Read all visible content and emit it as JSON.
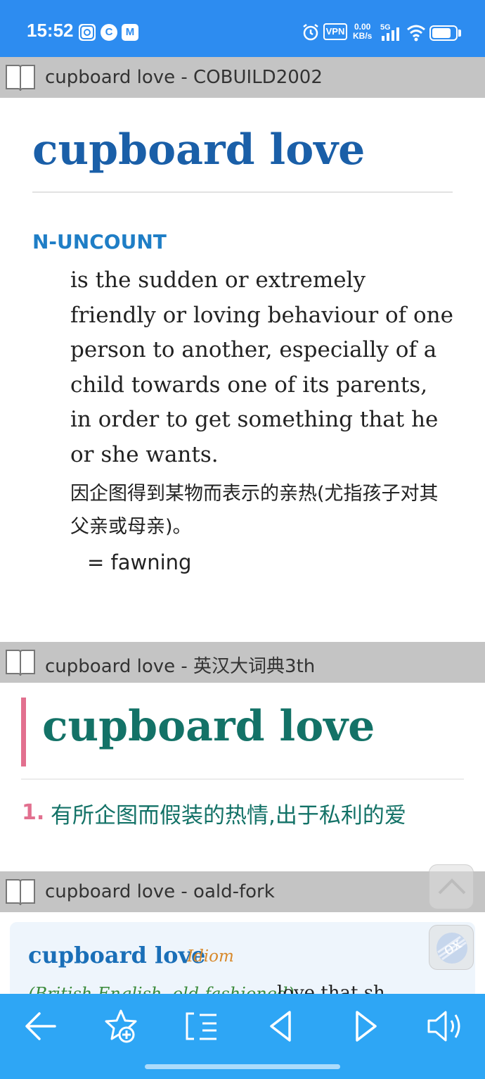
{
  "status_bar": {
    "time": "15:52",
    "app_icons": [
      "photo-app-icon",
      "browser-app-icon",
      "mail-app-icon"
    ],
    "app_letters": [
      "",
      "C",
      "M"
    ],
    "vpn": "VPN",
    "net_speed_value": "0.00",
    "net_speed_unit": "KB/s",
    "network": "5G",
    "battery_level": 0.8
  },
  "sections": {
    "cobuild": {
      "header": "cupboard love - COBUILD2002",
      "headword": "cupboard love",
      "pos": "N-UNCOUNT",
      "definition": "is the sudden or extremely friendly or loving behaviour of one person to another, especially of a child towards one of its parents, in order to get something that he or she wants.",
      "translation": "因企图得到某物而表示的亲热(尤指孩子对其父亲或母亲)。",
      "synonym": "= fawning"
    },
    "yinghan": {
      "header": "cupboard love - 英汉大词典3th",
      "headword": "cupboard love",
      "sense_number": "1.",
      "definition": "有所企图而假装的热情,出于私利的爱"
    },
    "oald": {
      "header": "cupboard love - oald-fork",
      "headword": "cupboard love",
      "label": "Idiom",
      "register": "(British English, old-fashioned)",
      "definition_start": "love that sh"
    }
  },
  "floating": {
    "ox_label": "ox"
  },
  "toolbar": {
    "buttons": [
      "back-arrow-icon",
      "add-favorite-icon",
      "word-list-icon",
      "previous-icon",
      "next-icon",
      "speaker-icon"
    ]
  },
  "colors": {
    "status_bar": "#2d8cf0",
    "toolbar": "#2ea6f5",
    "header_gray": "#c4c4c4",
    "cobuild_headword": "#1a5fa8",
    "cobuild_pos": "#1f7ec6",
    "yinghan_green": "#137267",
    "yinghan_pink": "#e2708f",
    "oald_label": "#d8892b"
  }
}
